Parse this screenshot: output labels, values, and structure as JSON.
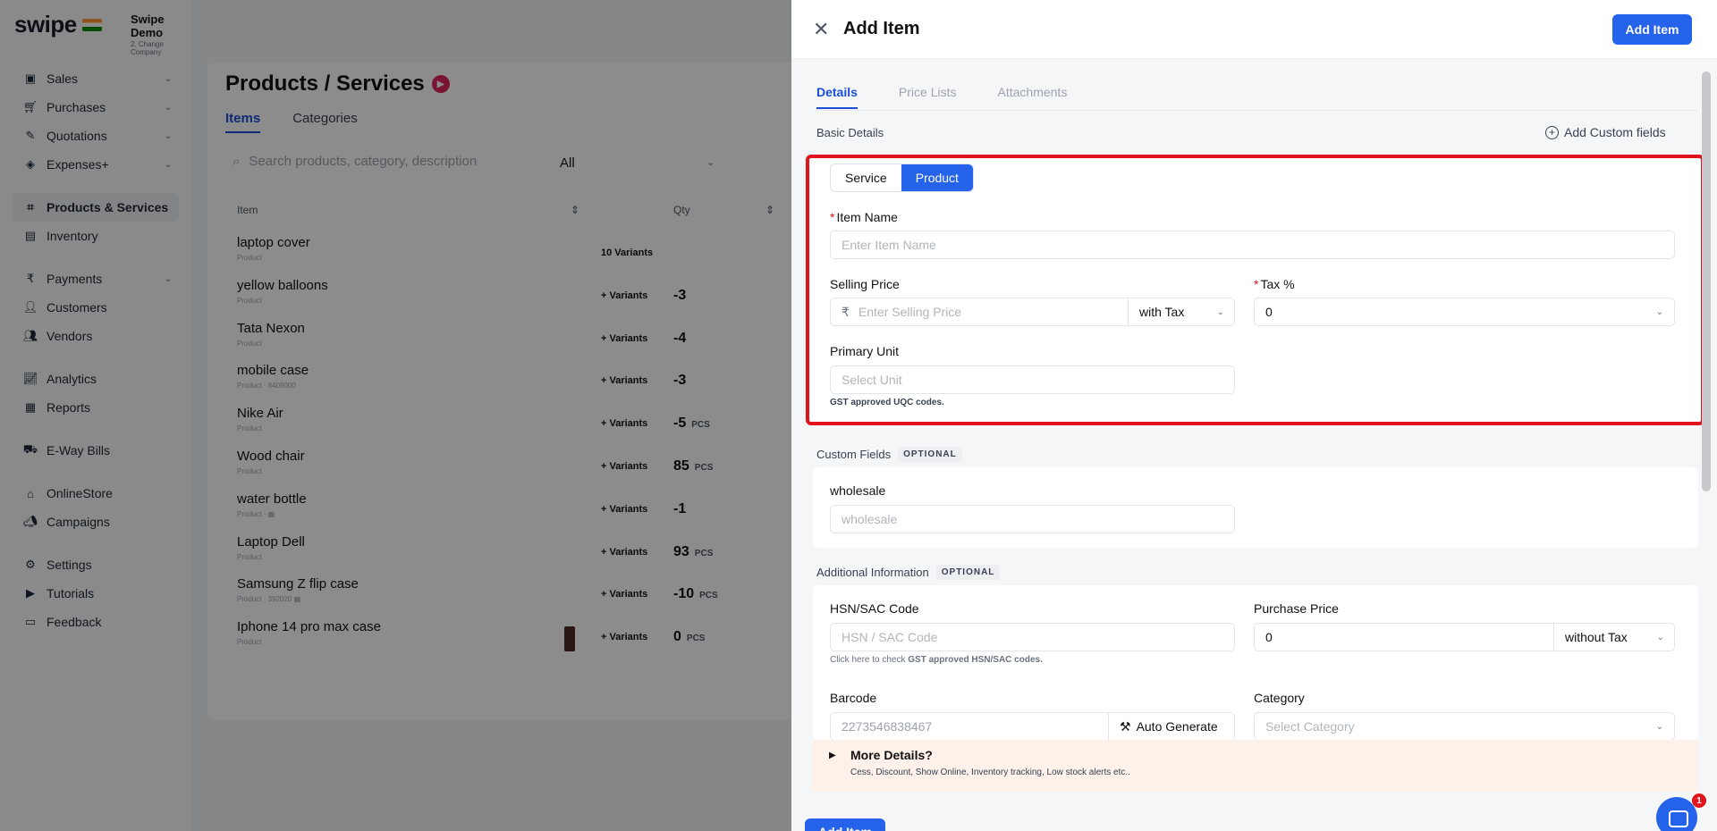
{
  "sidebar": {
    "brand": "swipe",
    "company_name": "Swipe Demo",
    "company_sub": "2. Change Company",
    "items": [
      {
        "label": "Sales",
        "icon": "cash-icon",
        "chevron": true
      },
      {
        "label": "Purchases",
        "icon": "cart-icon",
        "chevron": true
      },
      {
        "label": "Quotations",
        "icon": "pen-icon",
        "chevron": true
      },
      {
        "label": "Expenses+",
        "icon": "tag-icon",
        "chevron": true
      },
      {
        "label": "Products & Services",
        "icon": "box-icon",
        "chevron": false,
        "active": true
      },
      {
        "label": "Inventory",
        "icon": "inventory-icon",
        "chevron": false
      },
      {
        "label": "Payments",
        "icon": "rupee-icon",
        "chevron": true
      },
      {
        "label": "Customers",
        "icon": "user-icon",
        "chevron": false
      },
      {
        "label": "Vendors",
        "icon": "users-icon",
        "chevron": false
      },
      {
        "label": "Analytics",
        "icon": "chart-icon",
        "chevron": false
      },
      {
        "label": "Reports",
        "icon": "report-icon",
        "chevron": false
      },
      {
        "label": "E-Way Bills",
        "icon": "truck-icon",
        "chevron": false
      },
      {
        "label": "OnlineStore",
        "icon": "store-icon",
        "chevron": false
      },
      {
        "label": "Campaigns",
        "icon": "megaphone-icon",
        "chevron": false
      },
      {
        "label": "Settings",
        "icon": "gear-icon",
        "chevron": false
      },
      {
        "label": "Tutorials",
        "icon": "youtube-icon",
        "chevron": false
      },
      {
        "label": "Feedback",
        "icon": "message-icon",
        "chevron": false
      }
    ]
  },
  "products": {
    "title": "Products / Services",
    "tabs": [
      "Items",
      "Categories"
    ],
    "search_placeholder": "Search products, category, description",
    "filter": "All",
    "col_item": "Item",
    "col_qty": "Qty",
    "rows": [
      {
        "name": "laptop cover",
        "type": "Product",
        "variants": "10 Variants",
        "qty": "",
        "unit": ""
      },
      {
        "name": "yellow balloons",
        "type": "Product",
        "variants": "+ Variants",
        "qty": "-3",
        "unit": ""
      },
      {
        "name": "Tata Nexon",
        "type": "Product",
        "variants": "+ Variants",
        "qty": "-4",
        "unit": ""
      },
      {
        "name": "mobile case",
        "type": "Product · 8409000",
        "variants": "+ Variants",
        "qty": "-3",
        "unit": ""
      },
      {
        "name": "Nike Air",
        "type": "Product",
        "variants": "+ Variants",
        "qty": "-5",
        "unit": "PCS"
      },
      {
        "name": "Wood chair",
        "type": "Product",
        "variants": "+ Variants",
        "qty": "85",
        "unit": "PCS"
      },
      {
        "name": "water bottle",
        "type": "Product · ▦",
        "variants": "+ Variants",
        "qty": "-1",
        "unit": ""
      },
      {
        "name": "Laptop Dell",
        "type": "Product",
        "variants": "+ Variants",
        "qty": "93",
        "unit": "PCS"
      },
      {
        "name": "Samsung Z flip case",
        "type": "Product · 392020 ▦",
        "variants": "+ Variants",
        "qty": "-10",
        "unit": "PCS"
      },
      {
        "name": "Iphone 14 pro max case",
        "type": "Product",
        "variants": "+ Variants",
        "qty": "0",
        "unit": "PCS"
      }
    ]
  },
  "drawer": {
    "title": "Add Item",
    "header_button": "Add Item",
    "tabs": [
      "Details",
      "Price Lists",
      "Attachments"
    ],
    "basic_details": "Basic Details",
    "add_custom_fields": "Add Custom fields",
    "type_options": [
      "Service",
      "Product"
    ],
    "item_name_label": "Item Name",
    "item_name_placeholder": "Enter Item Name",
    "selling_price_label": "Selling Price",
    "currency_symbol": "₹",
    "selling_price_placeholder": "Enter Selling Price",
    "selling_price_tax_mode": "with Tax",
    "tax_label": "Tax %",
    "tax_value": "0",
    "primary_unit_label": "Primary Unit",
    "primary_unit_placeholder": "Select Unit",
    "uqc_hint": "GST approved UQC codes.",
    "custom_fields_label": "Custom Fields",
    "optional_tag": "OPTIONAL",
    "wholesale_label": "wholesale",
    "wholesale_placeholder": "wholesale",
    "additional_info_label": "Additional Information",
    "hsn_label": "HSN/SAC Code",
    "hsn_placeholder": "HSN / SAC Code",
    "hsn_hint_prefix": "Click here to check ",
    "hsn_hint_bold": "GST approved HSN/SAC codes.",
    "purchase_price_label": "Purchase Price",
    "purchase_price_value": "0",
    "purchase_tax_mode": "without Tax",
    "barcode_label": "Barcode",
    "barcode_value": "2273546838467",
    "auto_generate": "Auto Generate",
    "category_label": "Category",
    "category_placeholder": "Select Category",
    "more_details_title": "More Details?",
    "more_details_sub": "Cess, Discount, Show Online, Inventory tracking, Low stock alerts etc..",
    "footer_button": "Add Item",
    "chat_badge": "1"
  },
  "colors": {
    "accent": "#2563eb",
    "highlight_border": "#e1141e",
    "overlay": "rgba(0,0,0,0.45)"
  }
}
